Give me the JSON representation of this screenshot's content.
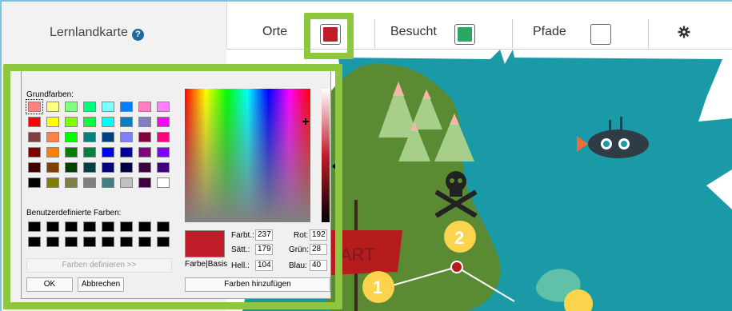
{
  "header": {
    "title": "Lernlandkarte",
    "help_icon": "?",
    "tabs": [
      {
        "label": "Orte",
        "color": "#c01c28"
      },
      {
        "label": "Besucht",
        "color": "#2aa862"
      },
      {
        "label": "Pfade",
        "color": "#ffffff"
      }
    ],
    "settings_icon": "gear-icon"
  },
  "dialog": {
    "basic_colors_label": "Grundfarben:",
    "custom_colors_label": "Benutzerdefinierte Farben:",
    "define_button": "Farben definieren >>",
    "ok_button": "OK",
    "cancel_button": "Abbrechen",
    "preview_label": "Farbe|Basis",
    "add_button": "Farben hinzufügen",
    "fields": {
      "hue_label": "Farbt.:",
      "hue": "237",
      "sat_label": "Sätt.:",
      "sat": "179",
      "lum_label": "Hell.:",
      "lum": "104",
      "red_label": "Rot:",
      "red": "192",
      "green_label": "Grün:",
      "green": "28",
      "blue_label": "Blau:",
      "blue": "40"
    },
    "basic_colors": [
      "#ff8080",
      "#ffff80",
      "#80ff80",
      "#00ff80",
      "#80ffff",
      "#0080ff",
      "#ff80c0",
      "#ff80ff",
      "#ff0000",
      "#ffff00",
      "#80ff00",
      "#00ff40",
      "#00ffff",
      "#0080c0",
      "#8080c0",
      "#ff00ff",
      "#804040",
      "#ff8040",
      "#00ff00",
      "#008080",
      "#004080",
      "#8080ff",
      "#800040",
      "#ff0080",
      "#800000",
      "#ff8000",
      "#008000",
      "#008040",
      "#0000ff",
      "#0000a0",
      "#800080",
      "#8000ff",
      "#400000",
      "#804000",
      "#004000",
      "#004040",
      "#000080",
      "#000040",
      "#400040",
      "#400080",
      "#000000",
      "#808000",
      "#808040",
      "#808080",
      "#408080",
      "#c0c0c0",
      "#400040",
      "#ffffff"
    ],
    "custom_colors": [
      "#000000",
      "#000000",
      "#000000",
      "#000000",
      "#000000",
      "#000000",
      "#000000",
      "#000000",
      "#000000",
      "#000000",
      "#000000",
      "#000000",
      "#000000",
      "#000000",
      "#000000",
      "#000000"
    ]
  },
  "map": {
    "start_sign": "ART",
    "stops": [
      "1",
      "2"
    ],
    "colors": {
      "sea": "#1a9aa6",
      "land": "#5a8a32",
      "stop": "#fcd34d",
      "sign": "#b71c1c"
    }
  }
}
